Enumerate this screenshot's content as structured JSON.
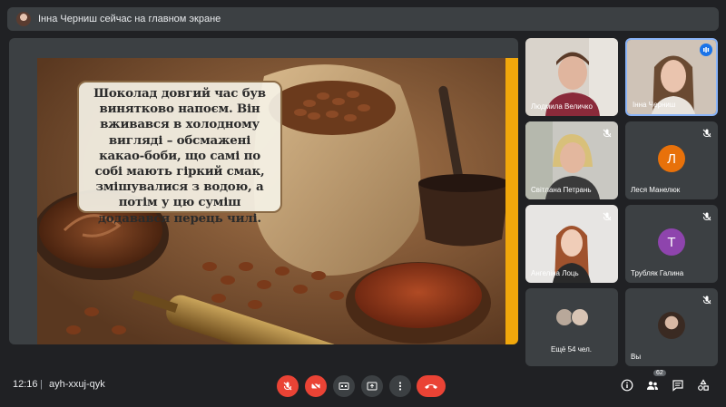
{
  "topbar": {
    "presenter_text": "Інна Черниш сейчас на главном экране"
  },
  "slide": {
    "caption": "Шоколад довгий час був винятково напоєм. Він вживався в холодному вигляді – обсмажені какао-боби, що самі по собі мають гіркий смак, змішувалися з водою, а потім у цю суміш додавався перець чилі."
  },
  "participants": [
    {
      "name": "Людмила Величко",
      "muted": false
    },
    {
      "name": "Інна Черниш",
      "muted": false,
      "speaking": true
    },
    {
      "name": "Світлана Петрань",
      "muted": true
    },
    {
      "name": "Леся Манелюк",
      "muted": true,
      "initial": "Л",
      "color": "#e8710a"
    },
    {
      "name": "Ангеліна Лоць",
      "muted": true
    },
    {
      "name": "Трубляк Галина",
      "muted": true,
      "initial": "Т",
      "color": "#8e44ad"
    },
    {
      "name": "Ещё 54 чел."
    },
    {
      "name": "Вы",
      "muted": true
    }
  ],
  "bottombar": {
    "time": "12:16",
    "separator": "|",
    "meeting_code": "ayh-xxuj-qyk",
    "people_count": "62"
  }
}
